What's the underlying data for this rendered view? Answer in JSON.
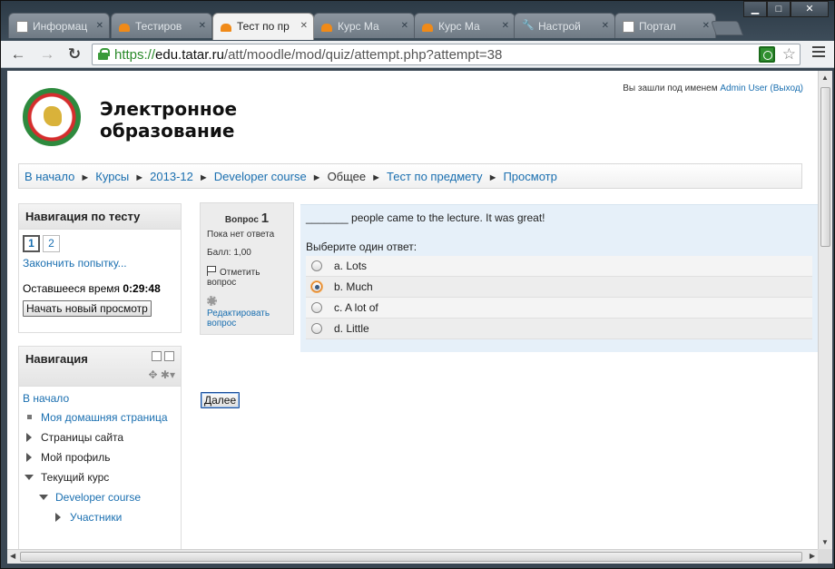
{
  "browser": {
    "tabs": [
      {
        "label": "Информац",
        "icon": "document-icon",
        "active": false
      },
      {
        "label": "Тестиров",
        "icon": "moodle-icon",
        "active": false
      },
      {
        "label": "Тест по пр",
        "icon": "moodle-icon",
        "active": true
      },
      {
        "label": "Курс Ма",
        "icon": "moodle-icon",
        "active": false
      },
      {
        "label": "Курс Ма",
        "icon": "moodle-icon",
        "active": false
      },
      {
        "label": "Настрой",
        "icon": "wrench-icon",
        "active": false
      },
      {
        "label": "Портал",
        "icon": "document-icon",
        "active": false
      }
    ],
    "url_scheme": "https://",
    "url_host": "edu.tatar.ru",
    "url_path": "/att/moodle/mod/quiz/attempt.php?attempt=38",
    "window_buttons": {
      "minimize": "▁",
      "maximize": "□",
      "close": "✕"
    }
  },
  "site": {
    "title_line1": "Электронное",
    "title_line2": "образование",
    "login_prefix": "Вы зашли под именем",
    "login_user": "Admin User",
    "logout": "(Выход)"
  },
  "breadcrumb": [
    {
      "label": "В начало",
      "link": true
    },
    {
      "label": "Курсы",
      "link": true
    },
    {
      "label": "2013-12",
      "link": true
    },
    {
      "label": "Developer course",
      "link": true
    },
    {
      "label": "Общее",
      "link": false
    },
    {
      "label": "Тест по предмету",
      "link": true
    },
    {
      "label": "Просмотр",
      "link": true
    }
  ],
  "quiz_nav": {
    "title": "Навигация по тесту",
    "questions": [
      "1",
      "2"
    ],
    "finish_link": "Закончить попытку...",
    "time_label": "Оставшееся время",
    "time_value": "0:29:48",
    "restart_button": "Начать новый просмотр"
  },
  "navigation": {
    "title": "Навигация",
    "home": "В начало",
    "items": [
      {
        "label": "Моя домашняя страница",
        "kind": "bullet",
        "link": true
      },
      {
        "label": "Страницы сайта",
        "kind": "collapsed",
        "link": false
      },
      {
        "label": "Мой профиль",
        "kind": "collapsed",
        "link": false
      },
      {
        "label": "Текущий курс",
        "kind": "expanded",
        "link": false
      }
    ],
    "course": "Developer course",
    "participants": "Участники"
  },
  "question": {
    "label": "Вопрос",
    "number": "1",
    "status": "Пока нет ответа",
    "mark": "Балл: 1,00",
    "flag": "Отметить вопрос",
    "edit": "Редактировать вопрос",
    "text": "_______ people came to the lecture. It was great!",
    "prompt": "Выберите один ответ:",
    "answers": [
      {
        "label": "a. Lots",
        "checked": false
      },
      {
        "label": "b. Much",
        "checked": true
      },
      {
        "label": "c. A lot of",
        "checked": false
      },
      {
        "label": "d. Little",
        "checked": false
      }
    ]
  },
  "next_button": "Далее"
}
